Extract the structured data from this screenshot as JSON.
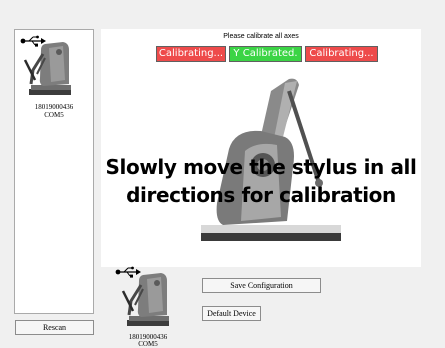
{
  "devices": [
    {
      "serial": "18019000436",
      "port": "COM5",
      "icon": "usb-icon"
    }
  ],
  "rescan_label": "Rescan",
  "calibration": {
    "title": "Please calibrate all axes",
    "axes": [
      {
        "label": "Calibrating...",
        "state": "calibrating",
        "color": "#ee4b4b"
      },
      {
        "label": "Y Calibrated.",
        "state": "calibrated",
        "color": "#3bd445"
      },
      {
        "label": "Calibrating...",
        "state": "calibrating",
        "color": "#ee4b4b"
      }
    ],
    "instruction_line1": "Slowly move the stylus in all",
    "instruction_line2": "directions for calibration"
  },
  "selected_device": {
    "serial": "18019000436",
    "port": "COM5"
  },
  "save_label": "Save Configuration",
  "default_label": "Default Device"
}
